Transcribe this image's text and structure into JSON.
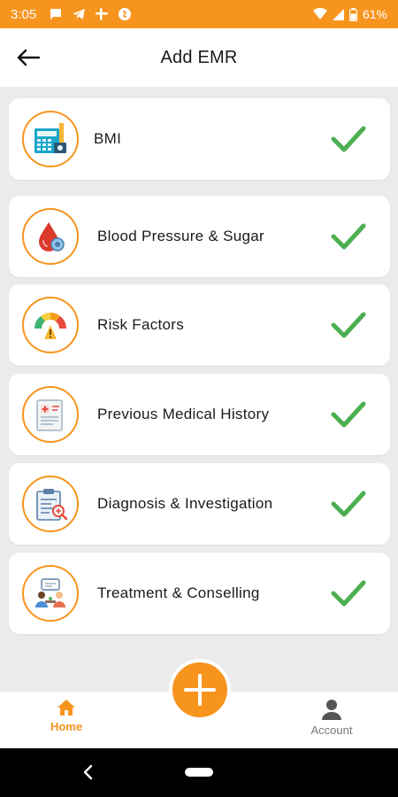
{
  "status_bar": {
    "time": "3:05",
    "battery_percent": "61%",
    "left_icons": [
      "message-icon",
      "telegram-icon",
      "slack-icon",
      "shazam-icon"
    ],
    "right_icons": [
      "wifi-icon",
      "signal-icon",
      "battery-icon"
    ]
  },
  "header": {
    "title": "Add EMR",
    "back_icon": "arrow-left-icon"
  },
  "cards": [
    {
      "label": "BMI",
      "icon": "bmi-calculator-icon",
      "status_icon": "check-icon",
      "completed": true
    },
    {
      "label": "Blood Pressure & Sugar",
      "icon": "blood-drop-icon",
      "status_icon": "check-icon",
      "completed": true
    },
    {
      "label": "Risk Factors",
      "icon": "risk-gauge-icon",
      "status_icon": "check-icon",
      "completed": true
    },
    {
      "label": "Previous Medical History",
      "icon": "medical-record-icon",
      "status_icon": "check-icon",
      "completed": true
    },
    {
      "label": "Diagnosis & Investigation",
      "icon": "clipboard-diagnosis-icon",
      "status_icon": "check-icon",
      "completed": true
    },
    {
      "label": "Treatment & Conselling",
      "icon": "counselling-icon",
      "status_icon": "check-icon",
      "completed": true
    }
  ],
  "fab": {
    "icon": "plus-icon"
  },
  "bottom_nav": {
    "items": [
      {
        "label": "Home",
        "icon": "home-icon",
        "active": true
      },
      {
        "label": "Account",
        "icon": "person-icon",
        "active": false
      }
    ]
  },
  "colors": {
    "accent": "#f7941d",
    "check": "#4caf50",
    "background": "#ebebeb",
    "card": "#ffffff"
  }
}
